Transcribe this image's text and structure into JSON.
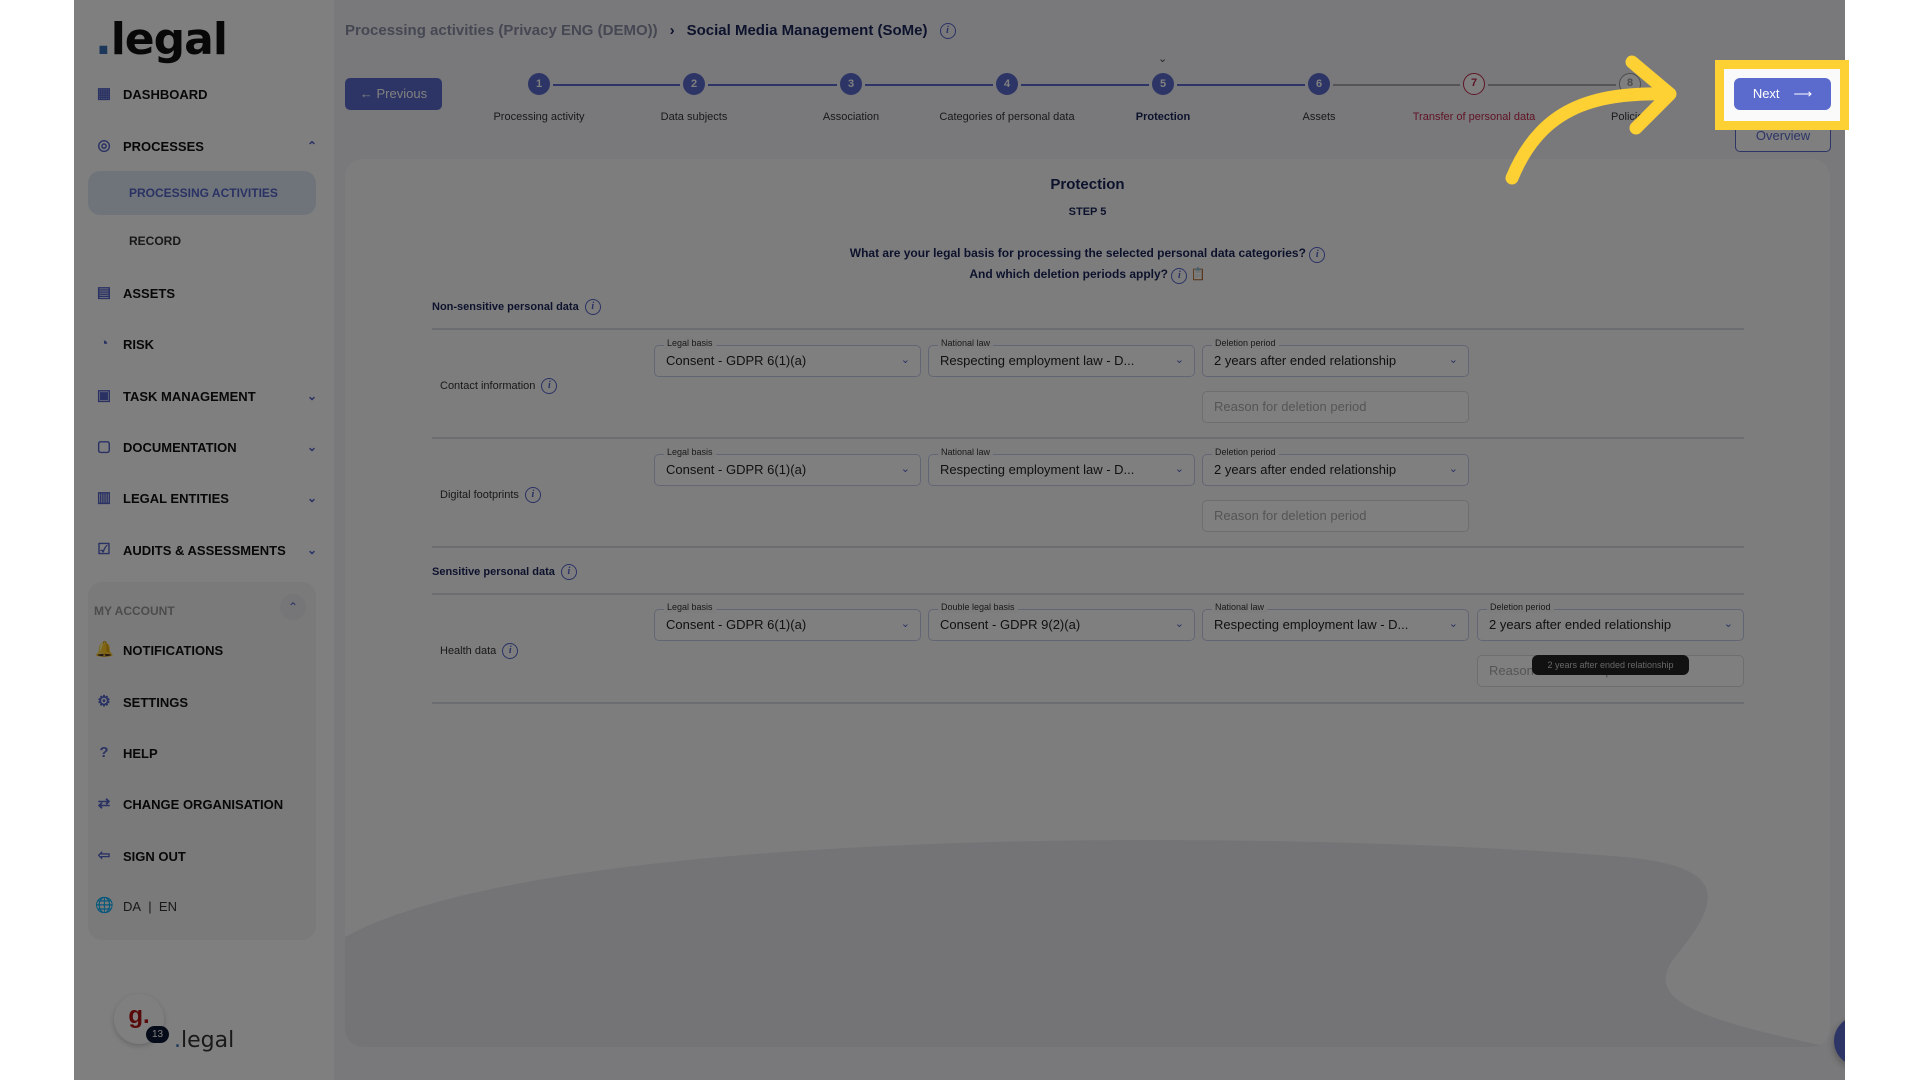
{
  "sidebar": {
    "logo": "legal",
    "items": [
      {
        "label": "DASHBOARD",
        "icon": "dashboard-icon"
      },
      {
        "label": "PROCESSES",
        "icon": "processes-icon",
        "expanded": true
      },
      {
        "label": "ASSETS",
        "icon": "assets-icon"
      },
      {
        "label": "RISK",
        "icon": "gauge-icon"
      },
      {
        "label": "TASK MANAGEMENT",
        "icon": "calendar-edit-icon"
      },
      {
        "label": "DOCUMENTATION",
        "icon": "document-icon"
      },
      {
        "label": "LEGAL ENTITIES",
        "icon": "building-icon"
      },
      {
        "label": "AUDITS & ASSESSMENTS",
        "icon": "checklist-icon"
      }
    ],
    "sub_items": [
      "PROCESSING ACTIVITIES",
      "RECORD"
    ],
    "account": {
      "title": "MY ACCOUNT",
      "items": [
        {
          "label": "NOTIFICATIONS",
          "icon": "bell-icon"
        },
        {
          "label": "SETTINGS",
          "icon": "gear-icon"
        },
        {
          "label": "HELP",
          "icon": "help-icon"
        },
        {
          "label": "CHANGE ORGANISATION",
          "icon": "switch-icon"
        },
        {
          "label": "SIGN OUT",
          "icon": "sign-out-icon"
        }
      ],
      "lang": {
        "da": "DA",
        "sep": "|",
        "en": "EN"
      }
    },
    "avatar_letter": "g.",
    "badge": "13",
    "footer_logo": "legal"
  },
  "breadcrumb": {
    "parent": "Processing activities (Privacy ENG (DEMO))",
    "current": "Social Media Management (SoMe)"
  },
  "nav": {
    "previous": "Previous",
    "next": "Next",
    "overview": "Overview"
  },
  "steps": [
    {
      "n": "1",
      "label": "Processing activity",
      "state": "done"
    },
    {
      "n": "2",
      "label": "Data subjects",
      "state": "done"
    },
    {
      "n": "3",
      "label": "Association",
      "state": "done"
    },
    {
      "n": "4",
      "label": "Categories of personal data",
      "state": "done"
    },
    {
      "n": "5",
      "label": "Protection",
      "state": "current"
    },
    {
      "n": "6",
      "label": "Assets",
      "state": "done"
    },
    {
      "n": "7",
      "label": "Transfer of personal data",
      "state": "error"
    },
    {
      "n": "8",
      "label": "Policies",
      "state": "todo"
    }
  ],
  "colors": {
    "accent": "#5b6acd",
    "error": "#c0284a",
    "highlight": "#fdd034",
    "navy": "#1b2559"
  },
  "content": {
    "title": "Protection",
    "step": "STEP 5",
    "question1": "What are your legal basis for processing the selected personal data categories?",
    "question2": "And which deletion periods apply?",
    "non_sensitive": "Non-sensitive personal data",
    "sensitive": "Sensitive personal data",
    "reason_placeholder": "Reason for deletion period",
    "tooltip": "2 years after ended relationship",
    "rows": [
      {
        "label": "Contact information",
        "fields": [
          {
            "label": "Legal basis",
            "value": "Consent - GDPR 6(1)(a)"
          },
          {
            "label": "National law",
            "value": "Respecting employment law - D..."
          },
          {
            "label": "Deletion period",
            "value": "2 years after ended relationship"
          }
        ]
      },
      {
        "label": "Digital footprints",
        "fields": [
          {
            "label": "Legal basis",
            "value": "Consent - GDPR 6(1)(a)"
          },
          {
            "label": "National law",
            "value": "Respecting employment law - D..."
          },
          {
            "label": "Deletion period",
            "value": "2 years after ended relationship"
          }
        ]
      },
      {
        "label": "Health data",
        "fields": [
          {
            "label": "Legal basis",
            "value": "Consent - GDPR 6(1)(a)"
          },
          {
            "label": "Double legal basis",
            "value": "Consent - GDPR 9(2)(a)"
          },
          {
            "label": "National law",
            "value": "Respecting employment law - D..."
          },
          {
            "label": "Deletion period",
            "value": "2 years after ended relationship"
          }
        ]
      }
    ]
  }
}
